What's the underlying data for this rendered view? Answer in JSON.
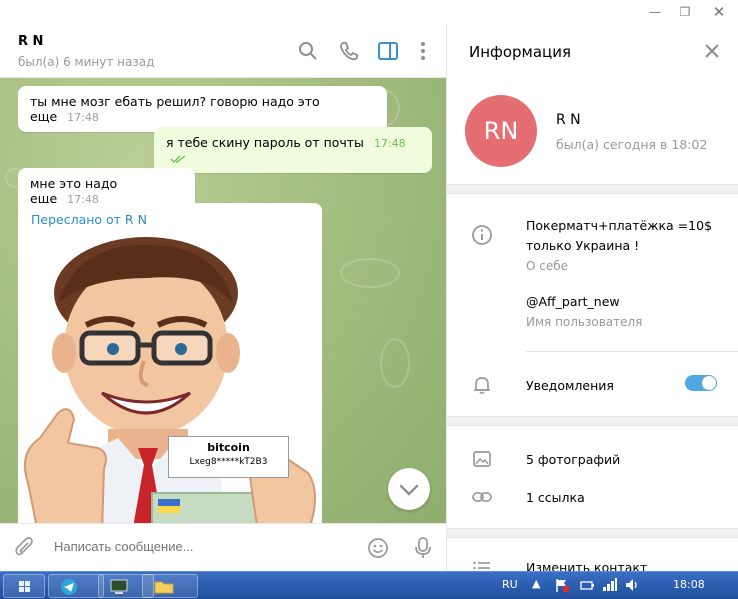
{
  "chat": {
    "name": "R N",
    "status": "был(а) 6 минут назад",
    "messages": [
      {
        "text": "ты мне мозг ебать решил? говорю надо это еще",
        "time": "17:48",
        "direction": "in"
      },
      {
        "text": "я тебе скину пароль от почты",
        "time": "17:48",
        "direction": "out",
        "read": true
      },
      {
        "text": "мне это надо еще",
        "time": "17:48",
        "direction": "in"
      }
    ],
    "forwarded": {
      "label": "Переслано от R N",
      "sticker_sign_title": "bitcoin",
      "sticker_sign_text": "Lxeg8*****kT2B3"
    },
    "compose_placeholder": "Написать сообщение..."
  },
  "info": {
    "title": "Информация",
    "avatar_initials": "RN",
    "avatar_color": "#e56e73",
    "name": "R N",
    "status": "был(а) сегодня в 18:02",
    "about_text_line1": "Покерматч+платёжка =10$",
    "about_text_line2": "только Украина !",
    "about_label": "О себе",
    "username": "@Aff_part_new",
    "username_label": "Имя пользователя",
    "notifications_label": "Уведомления",
    "notifications_enabled": true,
    "photos": "5 фотографий",
    "links": "1 ссылка",
    "edit_contact": "Изменить контакт"
  },
  "taskbar": {
    "lang": "RU",
    "clock": "18:08"
  },
  "colors": {
    "accent": "#4fa9e0",
    "forward_label": "#2a8ec5",
    "read_check": "#6cbf5b"
  }
}
